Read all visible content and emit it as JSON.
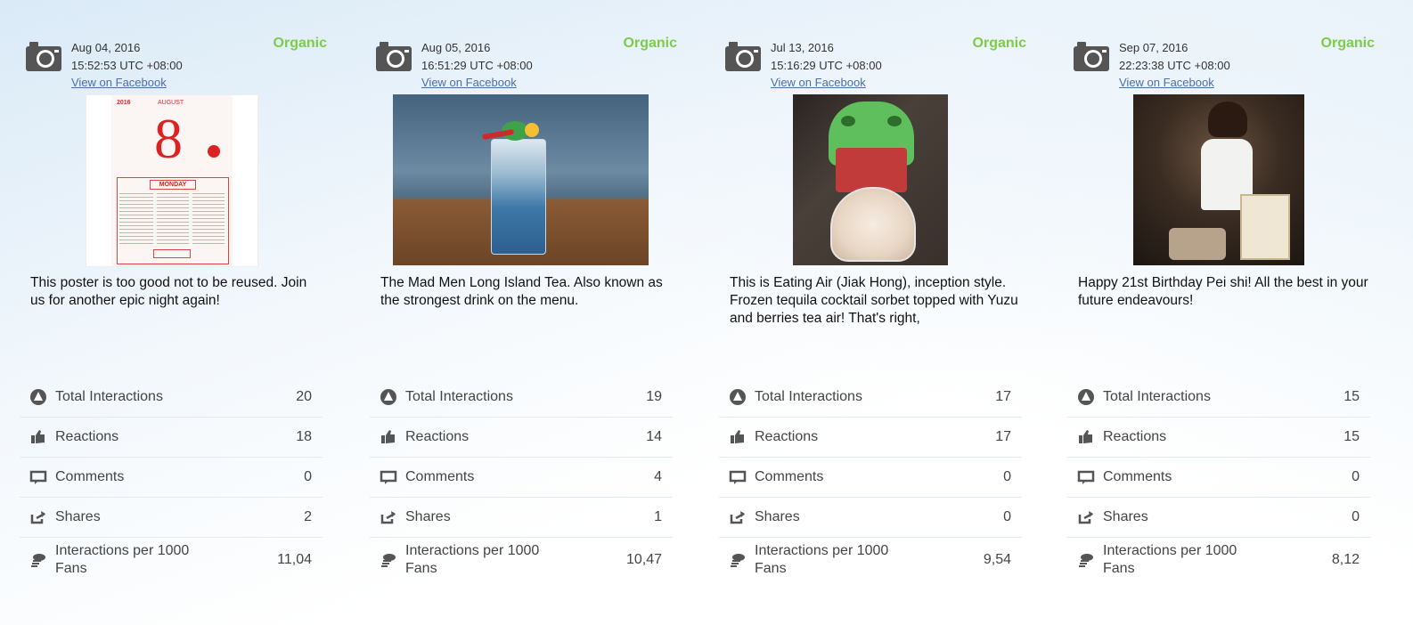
{
  "posts": [
    {
      "date": "Aug 04, 2016",
      "time": "15:52:53 UTC +08:00",
      "link": "View on Facebook",
      "type": "Organic",
      "caption": "This poster is too good not to be reused. Join us for another epic night again!",
      "poster": {
        "year": "2016",
        "month": "AUGUST",
        "day": "8",
        "weekday": "MONDAY"
      },
      "metrics": [
        {
          "label": "Total Interactions",
          "value": "20"
        },
        {
          "label": "Reactions",
          "value": "18"
        },
        {
          "label": "Comments",
          "value": "0"
        },
        {
          "label": "Shares",
          "value": "2"
        },
        {
          "label": "Interactions per 1000 Fans",
          "value": "11,04"
        }
      ]
    },
    {
      "date": "Aug 05, 2016",
      "time": "16:51:29 UTC +08:00",
      "link": "View on Facebook",
      "type": "Organic",
      "caption": "The Mad Men Long Island Tea. Also known as the strongest drink on the menu.",
      "metrics": [
        {
          "label": "Total Interactions",
          "value": "19"
        },
        {
          "label": "Reactions",
          "value": "14"
        },
        {
          "label": "Comments",
          "value": "4"
        },
        {
          "label": "Shares",
          "value": "1"
        },
        {
          "label": "Interactions per 1000 Fans",
          "value": "10,47"
        }
      ]
    },
    {
      "date": "Jul 13, 2016",
      "time": "15:16:29 UTC +08:00",
      "link": "View on Facebook",
      "type": "Organic",
      "caption": "This is Eating Air (Jiak Hong), inception style. Frozen tequila cocktail sorbet topped with Yuzu and berries tea air! That's right,",
      "metrics": [
        {
          "label": "Total Interactions",
          "value": "17"
        },
        {
          "label": "Reactions",
          "value": "17"
        },
        {
          "label": "Comments",
          "value": "0"
        },
        {
          "label": "Shares",
          "value": "0"
        },
        {
          "label": "Interactions per 1000 Fans",
          "value": "9,54"
        }
      ]
    },
    {
      "date": "Sep 07, 2016",
      "time": "22:23:38 UTC +08:00",
      "link": "View on Facebook",
      "type": "Organic",
      "caption": "Happy 21st Birthday Pei shi! All the best in your future endeavours!",
      "metrics": [
        {
          "label": "Total Interactions",
          "value": "15"
        },
        {
          "label": "Reactions",
          "value": "15"
        },
        {
          "label": "Comments",
          "value": "0"
        },
        {
          "label": "Shares",
          "value": "0"
        },
        {
          "label": "Interactions per 1000 Fans",
          "value": "8,12"
        }
      ]
    }
  ],
  "icons": [
    "camera-icon",
    "total-interactions-icon",
    "reactions-icon",
    "comments-icon",
    "shares-icon",
    "interactions-per-fans-icon"
  ],
  "colors": {
    "organic": "#7dcc49",
    "link": "#4b6ea9",
    "icon": "#555555"
  }
}
